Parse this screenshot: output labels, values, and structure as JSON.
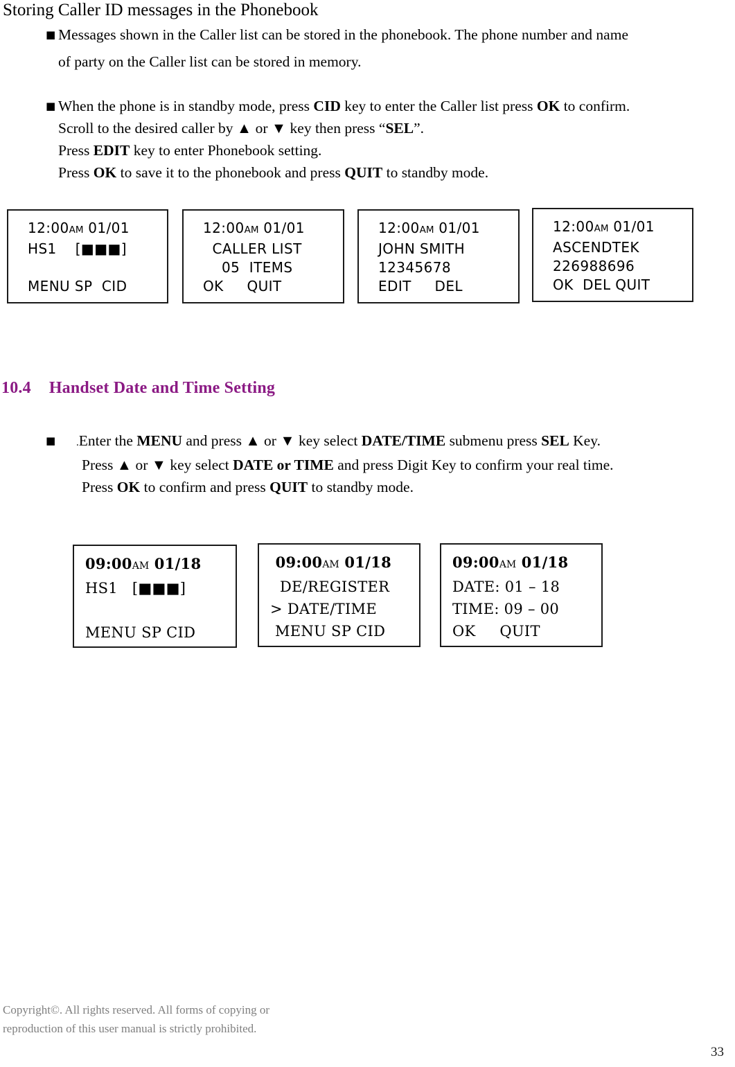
{
  "page": {
    "title": "Storing Caller ID messages in the Phonebook",
    "number": "33"
  },
  "intro_bullet": {
    "marker": "■",
    "line1": "Messages shown in the Caller list can be stored in the phonebook. The phone number and name",
    "line2": "of party on the Caller list can be stored in memory."
  },
  "steps_bullet": {
    "marker": "■",
    "line1_a": "When the phone is in standby mode, press ",
    "line1_b": "CID",
    "line1_c": " key to enter the Caller list press ",
    "line1_d": "OK",
    "line1_e": " to confirm.",
    "line2_a": "Scroll to the desired caller by ",
    "line2_up": "▲",
    "line2_b": " or ",
    "line2_down": "▼",
    "line2_c": " key then press “",
    "line2_d": "SEL",
    "line2_e": "”.",
    "line3_a": "Press ",
    "line3_b": "EDIT",
    "line3_c": " key to enter Phonebook setting.",
    "line4_a": "Press ",
    "line4_b": "OK",
    "line4_c": " to save it to the phonebook and press ",
    "line4_d": "QUIT",
    "line4_e": " to standby mode."
  },
  "screens_caller_id": [
    {
      "name": "standby-screen",
      "line1_time": "12:00",
      "line1_ampm": "AM",
      "line1_date": " 01/01",
      "line2": "HS1    [■■■]",
      "line3": "",
      "line4": "MENU SP  CID"
    },
    {
      "name": "caller-list-screen",
      "line1_time": "12:00",
      "line1_ampm": "AM",
      "line1_date": " 01/01",
      "line2": "  CALLER LIST",
      "line3": "    05  ITEMS",
      "line4": "OK     QUIT"
    },
    {
      "name": "caller-detail-screen",
      "line1_time": "12:00",
      "line1_ampm": "AM",
      "line1_date": " 01/01",
      "line2": "JOHN SMITH",
      "line3": "12345678",
      "line4": "EDIT     DEL"
    },
    {
      "name": "caller-save-screen",
      "line1_time": "12:00",
      "line1_ampm": "AM",
      "line1_date": " 01/01",
      "line2": "ASCENDTEK",
      "line3": "226988696",
      "line4": "OK  DEL QUIT"
    }
  ],
  "section": {
    "number": "10.4",
    "title": "Handset Date and Time Setting",
    "color": "#8B1A84"
  },
  "datetime_bullet": {
    "marker": "■",
    "lead_dot": ".",
    "line1_a": "Enter the ",
    "line1_b": "MENU",
    "line1_c": " and press ",
    "line1_up": "▲",
    "line1_d": " or ",
    "line1_down": "▼",
    "line1_e": " key select ",
    "line1_f": "DATE/TIME",
    "line1_g": " submenu press ",
    "line1_h": "SEL",
    "line1_i": " Key.",
    "line2_a": "Press ",
    "line2_up": "▲",
    "line2_b": " or ",
    "line2_down": "▼",
    "line2_c": " key select ",
    "line2_d": "DATE or TIME",
    "line2_e": " and press Digit Key to confirm your real time.",
    "line3_a": "Press ",
    "line3_b": "OK",
    "line3_c": " to confirm and press ",
    "line3_d": "QUIT",
    "line3_e": " to standby mode."
  },
  "screens_datetime": [
    {
      "name": "handset-standby-screen",
      "line1_time": "09:00",
      "line1_ampm": "AM",
      "line1_date": " 01/18",
      "line2": "HS1   [■■■]",
      "line3": "",
      "line4": "MENU SP CID"
    },
    {
      "name": "menu-datetime-screen",
      "line1_time": " 09:00",
      "line1_ampm": "AM",
      "line1_date": " 01/18",
      "line2": "  DE/REGISTER",
      "line3": "> DATE/TIME",
      "line4": " MENU SP CID"
    },
    {
      "name": "date-time-edit-screen",
      "line1_time": "09:00",
      "line1_ampm": "AM",
      "line1_date": " 01/18",
      "line2": "DATE: 01 – 18",
      "line3": "TIME: 09 – 00",
      "line4": "OK     QUIT"
    }
  ],
  "footer": {
    "line1": "Copyright©. All rights reserved. All forms of copying or",
    "line2": "reproduction of this user manual is strictly prohibited."
  }
}
